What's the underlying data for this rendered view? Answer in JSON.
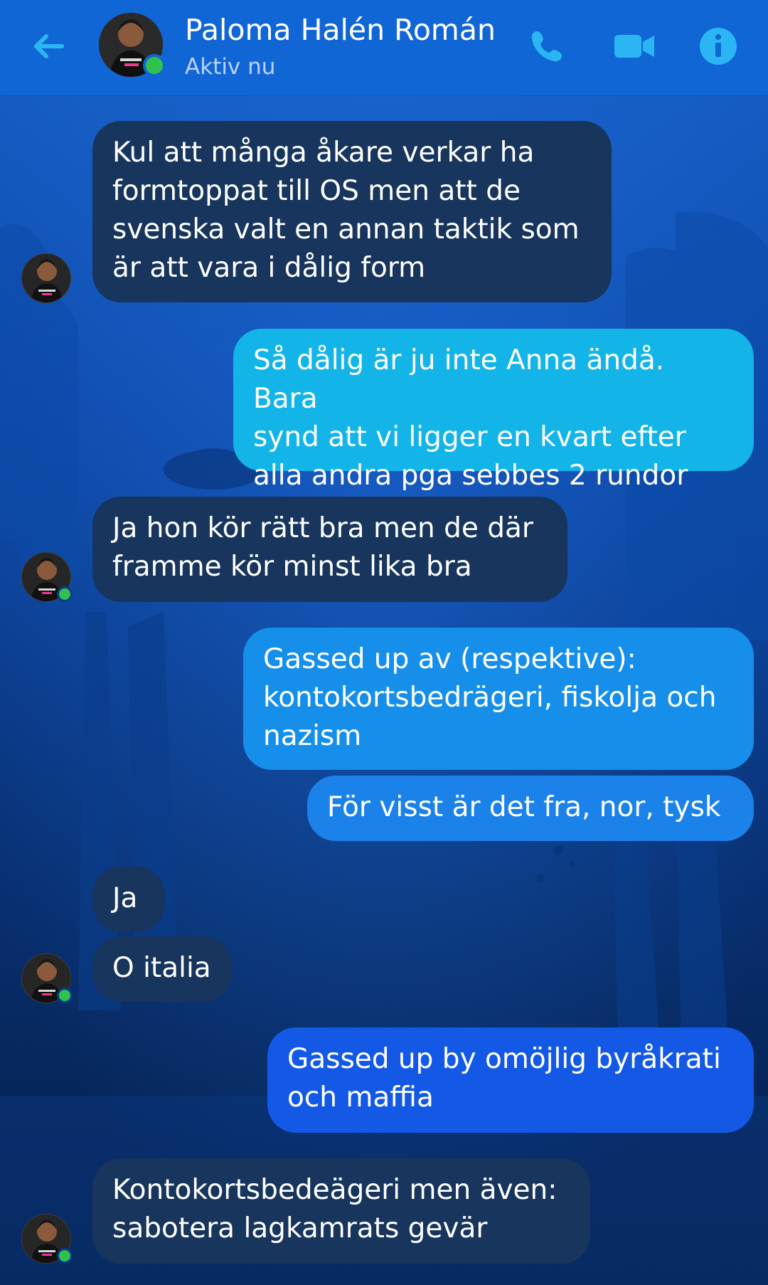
{
  "header": {
    "contact_name": "Paloma Halén Román",
    "status_text": "Aktiv nu",
    "back_icon": "arrow-left-icon",
    "call_icon": "phone-icon",
    "video_icon": "video-camera-icon",
    "info_icon": "info-icon",
    "accent_color": "#1166d5",
    "icon_color": "#2bb6f3"
  },
  "messages": [
    {
      "side": "incoming",
      "text": "Kul att många åkare verkar ha\nformtoppat till OS men att de\nsvenska valt en annan taktik som\när att vara i dålig form"
    },
    {
      "side": "outgoing",
      "text": "Så dålig är ju inte Anna ändå. Bara\nsynd att vi ligger en kvart efter\nalla andra pga sebbes 2 rundor"
    },
    {
      "side": "incoming",
      "text": "Ja hon kör rätt bra men de där\nframme kör minst lika bra"
    },
    {
      "side": "outgoing",
      "text": "Gassed up av (respektive):\nkontokortsbedrägeri, fiskolja och\nnazism"
    },
    {
      "side": "outgoing",
      "text": "För visst är det fra, nor, tysk"
    },
    {
      "side": "incoming",
      "text": "Ja"
    },
    {
      "side": "incoming",
      "text": "O italia"
    },
    {
      "side": "outgoing",
      "text": "Gassed up by omöjlig byråkrati\noch maffia"
    },
    {
      "side": "incoming",
      "text": "Kontokortsbedeägeri men även:\nsabotera lagkamrats gevär"
    }
  ],
  "colors": {
    "incoming_bubble": "#17355d",
    "outgoing_gradient": [
      "#13b4e8",
      "#158fe9",
      "#1b82ea",
      "#1459e6"
    ],
    "online_dot": "#31c24d"
  }
}
